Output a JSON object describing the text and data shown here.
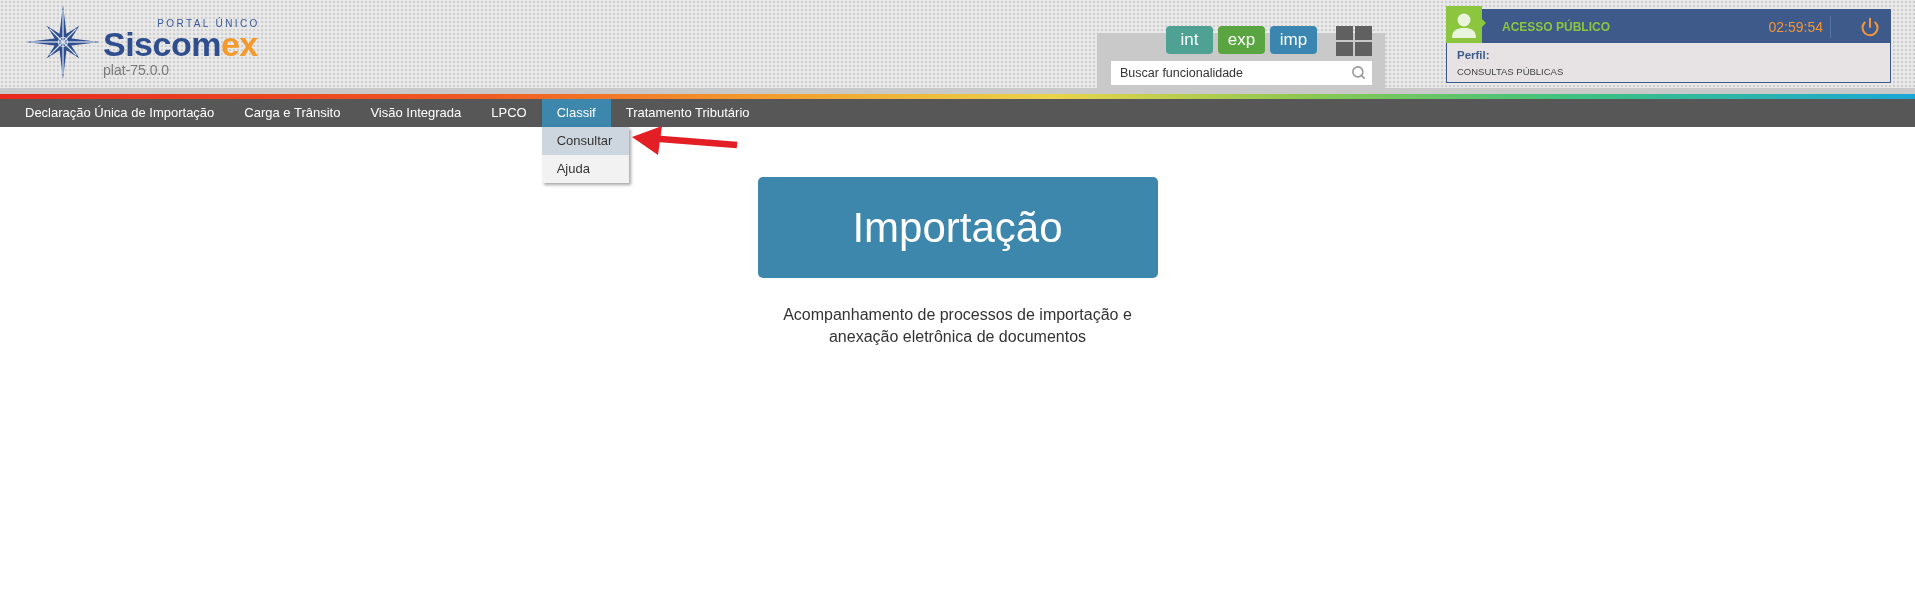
{
  "header": {
    "logo": {
      "tagline": "PORTAL ÚNICO",
      "wordmark": {
        "main": "Siscom",
        "accent": "ex"
      },
      "version": "plat-75.0.0"
    },
    "modes": [
      {
        "label": "int",
        "color": "#4ea193"
      },
      {
        "label": "exp",
        "color": "#5aa442"
      },
      {
        "label": "imp",
        "color": "#3a86b0"
      }
    ],
    "search": {
      "placeholder": "Buscar funcionalidade"
    },
    "user_panel": {
      "title": "ACESSO PÚBLICO",
      "timer": "02:59:54",
      "profile_label": "Perfil:",
      "profile": "CONSULTAS PÚBLICAS"
    }
  },
  "nav": {
    "items": [
      {
        "label": "Declaração Única de Importação",
        "selected": false
      },
      {
        "label": "Carga e Trânsito",
        "selected": false
      },
      {
        "label": "Visão Integrada",
        "selected": false
      },
      {
        "label": "LPCO",
        "selected": false
      },
      {
        "label": "Classif",
        "selected": true,
        "menu": [
          {
            "label": "Consultar",
            "selected": true
          },
          {
            "label": "Ajuda",
            "selected": false
          }
        ]
      },
      {
        "label": "Tratamento Tributário",
        "selected": false
      }
    ]
  },
  "main": {
    "title": "Importação",
    "description": "Acompanhamento de processos de importação e anexação eletrônica de documentos"
  }
}
